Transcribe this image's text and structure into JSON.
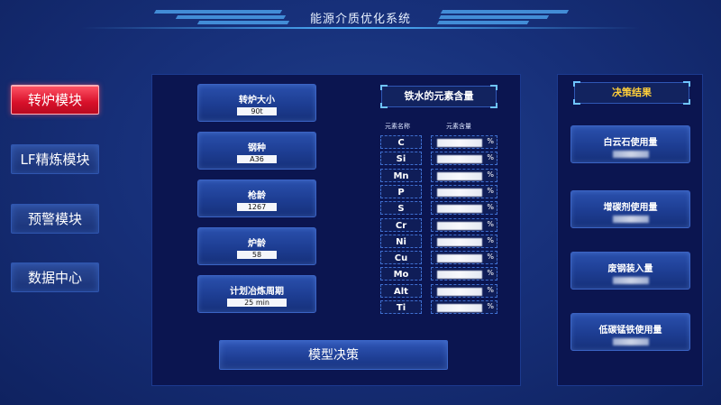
{
  "header": {
    "title": "能源介质优化系统"
  },
  "nav": {
    "items": [
      {
        "label": "转炉模块",
        "active": true
      },
      {
        "label": "LF精炼模块",
        "active": false
      },
      {
        "label": "预警模块",
        "active": false
      },
      {
        "label": "数据中心",
        "active": false
      }
    ]
  },
  "inputs": {
    "furnace_size": {
      "label": "转炉大小",
      "value": "90t"
    },
    "steel_grade": {
      "label": "钢种",
      "value": "A36"
    },
    "gun_age": {
      "label": "枪龄",
      "value": "1267"
    },
    "furnace_age": {
      "label": "炉龄",
      "value": "58"
    },
    "cycle": {
      "label": "计划冶炼周期",
      "value": "25 min"
    }
  },
  "elements": {
    "title": "铁水的元素含量",
    "col_name": "元素名称",
    "col_content": "元素含量",
    "unit": "%",
    "rows": [
      "C",
      "Si",
      "Mn",
      "P",
      "S",
      "Cr",
      "Ni",
      "Cu",
      "Mo",
      "Alt",
      "Ti"
    ]
  },
  "decide_button": "模型决策",
  "results": {
    "title": "决策结果",
    "items": [
      {
        "label": "白云石使用量"
      },
      {
        "label": "增碳剂使用量"
      },
      {
        "label": "废钢装入量"
      },
      {
        "label": "低碳锰铁使用量"
      }
    ]
  },
  "colors": {
    "accent_red": "#d8102a",
    "result_title": "#ffcf3a",
    "background": "#17307a"
  }
}
